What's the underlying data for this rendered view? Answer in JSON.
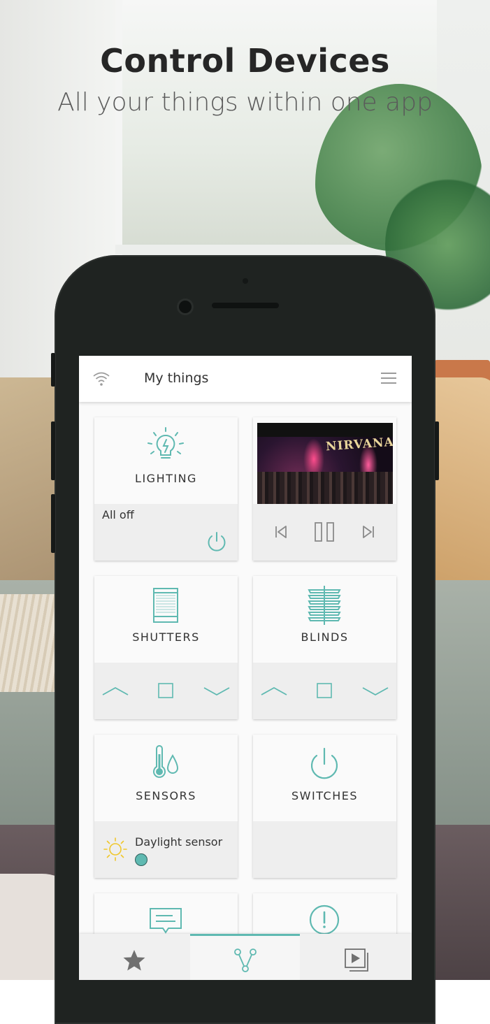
{
  "hero": {
    "title": "Control Devices",
    "subtitle": "All your things within one app"
  },
  "app": {
    "title": "My things",
    "accent_color": "#5fb9b1",
    "icons": {
      "status": "wifi-icon",
      "menu": "hamburger-menu-icon"
    }
  },
  "tiles": {
    "lighting": {
      "label": "LIGHTING",
      "status": "All off",
      "icon": "light-bulb-icon",
      "action_icon": "power-icon"
    },
    "media": {
      "album_text": "NIRVANA",
      "controls": [
        "previous-icon",
        "pause-icon",
        "next-icon"
      ]
    },
    "shutters": {
      "label": "SHUTTERS",
      "icon": "shutter-icon",
      "controls": [
        "up-icon",
        "stop-icon",
        "down-icon"
      ]
    },
    "blinds": {
      "label": "BLINDS",
      "icon": "blinds-icon",
      "controls": [
        "up-icon",
        "stop-icon",
        "down-icon"
      ]
    },
    "sensors": {
      "label": "SENSORS",
      "icon": "thermometer-drop-icon",
      "sensor_name": "Daylight sensor",
      "sensor_icon": "sun-icon"
    },
    "switches": {
      "label": "SWITCHES",
      "icon": "power-icon"
    },
    "messages": {
      "icon": "message-icon"
    },
    "alerts": {
      "icon": "alert-icon"
    }
  },
  "bottom_nav": {
    "items": [
      "star-icon",
      "network-icon",
      "media-icon"
    ],
    "active_index": 1
  }
}
